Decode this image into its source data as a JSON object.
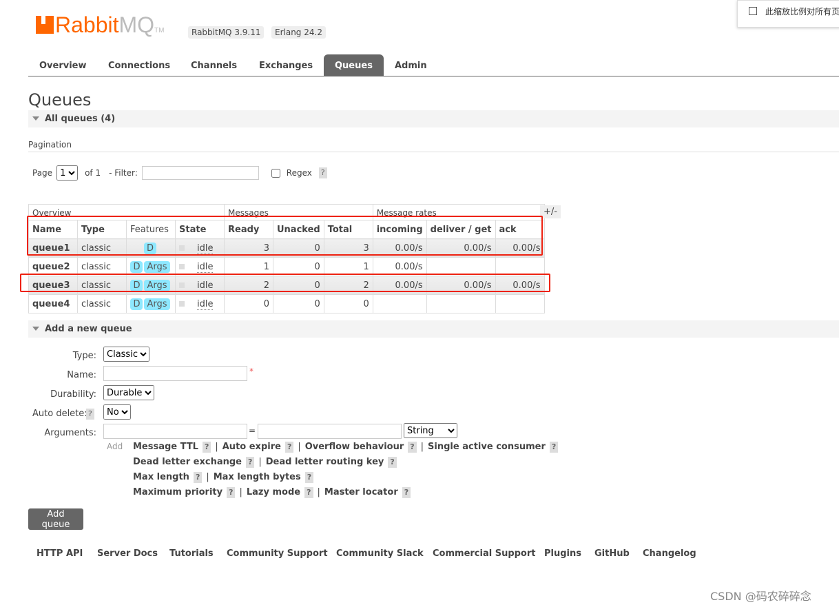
{
  "header": {
    "logo_rabbit": "Rabbit",
    "logo_mq": "MQ",
    "logo_tm": "TM",
    "version": "RabbitMQ 3.9.11",
    "erlang": "Erlang 24.2"
  },
  "popup": {
    "text": "此缩放比例对所有页"
  },
  "nav": [
    "Overview",
    "Connections",
    "Channels",
    "Exchanges",
    "Queues",
    "Admin"
  ],
  "active_tab": "Queues",
  "page_title": "Queues",
  "all_queues": "All queues (4)",
  "pagination": {
    "title": "Pagination",
    "page_label": "Page",
    "page_value": "1",
    "of": "of 1",
    "filter_label": "- Filter:",
    "filter_value": "",
    "regex": "Regex",
    "help": "?"
  },
  "table": {
    "groups": [
      "Overview",
      "Messages",
      "Message rates"
    ],
    "plusminus": "+/-",
    "columns": [
      "Name",
      "Type",
      "Features",
      "State",
      "Ready",
      "Unacked",
      "Total",
      "incoming",
      "deliver / get",
      "ack"
    ],
    "rows": [
      {
        "name": "queue1",
        "type": "classic",
        "features": [
          "D"
        ],
        "state": "idle",
        "ready": "3",
        "unacked": "0",
        "total": "3",
        "incoming": "0.00/s",
        "deliver": "0.00/s",
        "ack": "0.00/s"
      },
      {
        "name": "queue2",
        "type": "classic",
        "features": [
          "D",
          "Args"
        ],
        "state": "idle",
        "ready": "1",
        "unacked": "0",
        "total": "1",
        "incoming": "0.00/s",
        "deliver": "",
        "ack": ""
      },
      {
        "name": "queue3",
        "type": "classic",
        "features": [
          "D",
          "Args"
        ],
        "state": "idle",
        "ready": "2",
        "unacked": "0",
        "total": "2",
        "incoming": "0.00/s",
        "deliver": "0.00/s",
        "ack": "0.00/s"
      },
      {
        "name": "queue4",
        "type": "classic",
        "features": [
          "D",
          "Args"
        ],
        "state": "idle",
        "ready": "0",
        "unacked": "0",
        "total": "0",
        "incoming": "",
        "deliver": "",
        "ack": ""
      }
    ]
  },
  "add_queue": {
    "title": "Add a new queue",
    "type_label": "Type:",
    "type_value": "Classic",
    "name_label": "Name:",
    "required": "*",
    "durability_label": "Durability:",
    "durability_value": "Durable",
    "autodelete_label": "Auto delete:",
    "autodelete_value": "No",
    "arguments_label": "Arguments:",
    "eq": "=",
    "arg_type": "String",
    "add": "Add",
    "arg_lines": [
      [
        "Message TTL",
        "Auto expire",
        "Overflow behaviour",
        "Single active consumer"
      ],
      [
        "Dead letter exchange",
        "Dead letter routing key"
      ],
      [
        "Max length",
        "Max length bytes"
      ],
      [
        "Maximum priority",
        "Lazy mode",
        "Master locator"
      ]
    ],
    "submit": "Add queue"
  },
  "footer": [
    "HTTP API",
    "Server Docs",
    "Tutorials",
    "Community Support",
    "Community Slack",
    "Commercial Support",
    "Plugins",
    "GitHub",
    "Changelog"
  ],
  "watermark": "CSDN @码农碎碎念"
}
